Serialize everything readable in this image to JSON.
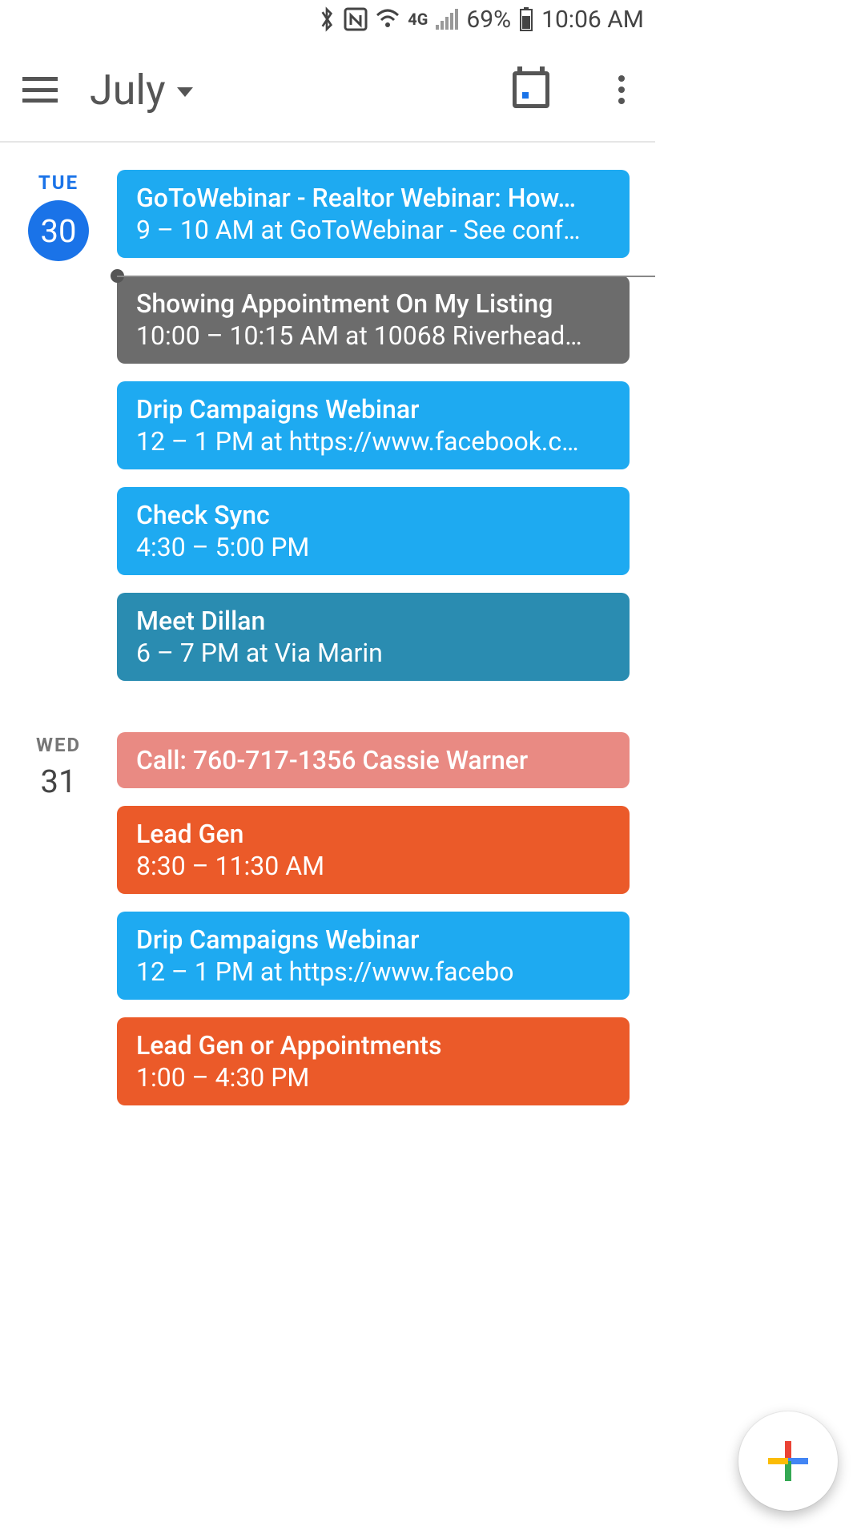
{
  "status": {
    "bluetooth_icon": "bluetooth",
    "nfc_icon": "nfc",
    "wifi_icon": "wifi",
    "network_label": "4G",
    "signal_icon": "signal",
    "battery_pct": "69%",
    "battery_icon": "battery",
    "time": "10:06 AM"
  },
  "header": {
    "month_label": "July"
  },
  "days": [
    {
      "dow": "TUE",
      "dow_color": "#1a73e8",
      "num": "30",
      "is_today": true,
      "events": [
        {
          "title": "GoToWebinar - Realtor Webinar: How…",
          "sub": "9 – 10 AM at GoToWebinar - See conf…",
          "color": "c-blue",
          "now_after": true
        },
        {
          "title": "Showing Appointment On My Listing",
          "sub": "10:00 – 10:15 AM at 10068 Riverhead…",
          "color": "c-grey"
        },
        {
          "title": "Drip Campaigns Webinar",
          "sub": "12 – 1 PM at https://www.facebook.c…",
          "color": "c-blue"
        },
        {
          "title": "Check Sync",
          "sub": "4:30 – 5:00 PM",
          "color": "c-blue"
        },
        {
          "title": "Meet Dillan",
          "sub": "6 – 7 PM at Via Marin",
          "color": "c-teal"
        }
      ]
    },
    {
      "dow": "WED",
      "dow_color": "#777",
      "num": "31",
      "is_today": false,
      "events": [
        {
          "title": "Call: 760-717-1356 Cassie Warner",
          "sub": "",
          "color": "c-salmon"
        },
        {
          "title": "Lead Gen",
          "sub": "8:30 – 11:30 AM",
          "color": "c-orange"
        },
        {
          "title": "Drip Campaigns Webinar",
          "sub": "12 – 1 PM at https://www.facebo",
          "color": "c-blue"
        },
        {
          "title": "Lead Gen or Appointments",
          "sub": "1:00 – 4:30 PM",
          "color": "c-orange"
        }
      ]
    }
  ]
}
